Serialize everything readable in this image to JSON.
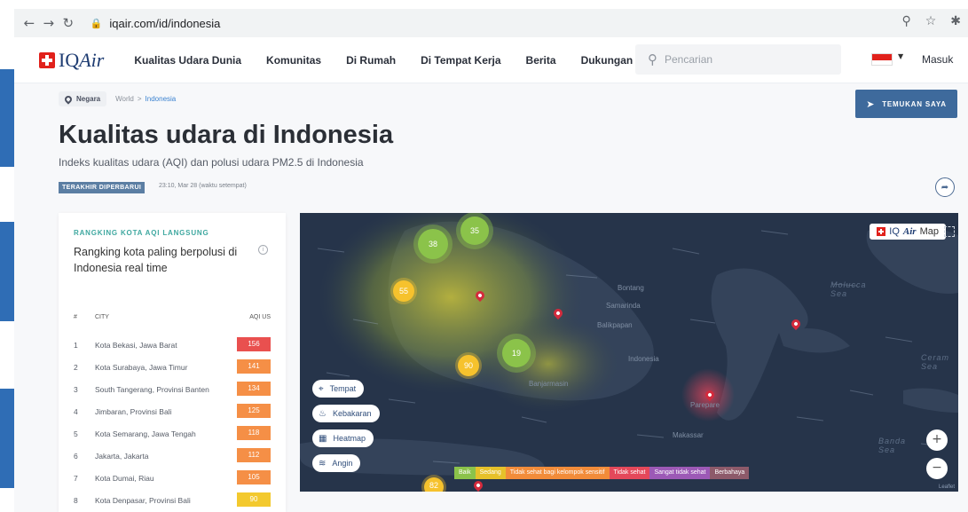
{
  "browser": {
    "url": "iqair.com/id/indonesia",
    "icons": [
      "back-icon",
      "forward-icon",
      "reload-icon",
      "lock-icon",
      "zoom-icon",
      "star-icon",
      "extensions-icon"
    ]
  },
  "header": {
    "logo_iq": "IQ",
    "logo_air": "Air",
    "menu": [
      "Kualitas Udara Dunia",
      "Komunitas",
      "Di Rumah",
      "Di Tempat Kerja",
      "Berita",
      "Dukungan"
    ],
    "search_placeholder": "Pencarian",
    "login": "Masuk"
  },
  "breadcrumb": {
    "root": "Negara",
    "world": "World",
    "sep": ">",
    "current": "Indonesia"
  },
  "find_me": "TEMUKAN SAYA",
  "page": {
    "title": "Kualitas udara di Indonesia",
    "subtitle": "Indeks kualitas udara (AQI) dan polusi udara PM2.5 di Indonesia",
    "updated_label": "TERAKHIR DIPERBARUI",
    "updated_time": "23:10, Mar 28 (waktu setempat)"
  },
  "ranking": {
    "kicker": "RANGKING KOTA AQI LANGSUNG",
    "title": "Rangking kota paling berpolusi di Indonesia real time",
    "col_num": "#",
    "col_city": "CITY",
    "col_aqi": "AQI US",
    "rows": [
      {
        "num": "1",
        "city": "Kota Bekasi, Jawa Barat",
        "aqi": "156",
        "color": "#e9504f"
      },
      {
        "num": "2",
        "city": "Kota Surabaya, Jawa Timur",
        "aqi": "141",
        "color": "#f58f46"
      },
      {
        "num": "3",
        "city": "South Tangerang, Provinsi Banten",
        "aqi": "134",
        "color": "#f58f46"
      },
      {
        "num": "4",
        "city": "Jimbaran, Provinsi Bali",
        "aqi": "125",
        "color": "#f58f46"
      },
      {
        "num": "5",
        "city": "Kota Semarang, Jawa Tengah",
        "aqi": "118",
        "color": "#f58f46"
      },
      {
        "num": "6",
        "city": "Jakarta, Jakarta",
        "aqi": "112",
        "color": "#f58f46"
      },
      {
        "num": "7",
        "city": "Kota Dumai, Riau",
        "aqi": "105",
        "color": "#f58f46"
      },
      {
        "num": "8",
        "city": "Kota Denpasar, Provinsi Bali",
        "aqi": "90",
        "color": "#f3c92e"
      }
    ]
  },
  "map": {
    "logo_iq": "IQ",
    "logo_air": "Air",
    "logo_map": "Map",
    "clusters": [
      {
        "value": "38",
        "color": "#8bc34a"
      },
      {
        "value": "35",
        "color": "#8bc34a"
      },
      {
        "value": "55",
        "color": "#f6c22d"
      },
      {
        "value": "19",
        "color": "#8bc34a"
      },
      {
        "value": "90",
        "color": "#f6c22d"
      },
      {
        "value": "82",
        "color": "#f6c22d"
      }
    ],
    "labels": {
      "bontang": "Bontang",
      "samarinda": "Samarinda",
      "balikpapan": "Balikpapan",
      "indonesia": "Indonesia",
      "banjarmasin": "Banjarmasin",
      "parepare": "Parepare",
      "makassar": "Makassar",
      "molucca": "Molucca Sea",
      "ceram": "Ceram Sea",
      "banda": "Banda Sea"
    },
    "layers": [
      {
        "label": "Tempat",
        "icon": "pin-icon"
      },
      {
        "label": "Kebakaran",
        "icon": "fire-icon"
      },
      {
        "label": "Heatmap",
        "icon": "heatmap-icon"
      },
      {
        "label": "Angin",
        "icon": "wind-icon"
      }
    ],
    "legend": [
      {
        "label": "Baik",
        "color": "#8bc34a"
      },
      {
        "label": "Sedang",
        "color": "#e6c12a"
      },
      {
        "label": "Tidak sehat bagi kelompok sensitif",
        "color": "#f28c3a"
      },
      {
        "label": "Tidak sehat",
        "color": "#e4485a"
      },
      {
        "label": "Sangat tidak sehat",
        "color": "#9c59b6"
      },
      {
        "label": "Berbahaya",
        "color": "#8d5a6a"
      }
    ],
    "zoom_in": "+",
    "zoom_out": "−",
    "attribution": "Leaflet"
  }
}
